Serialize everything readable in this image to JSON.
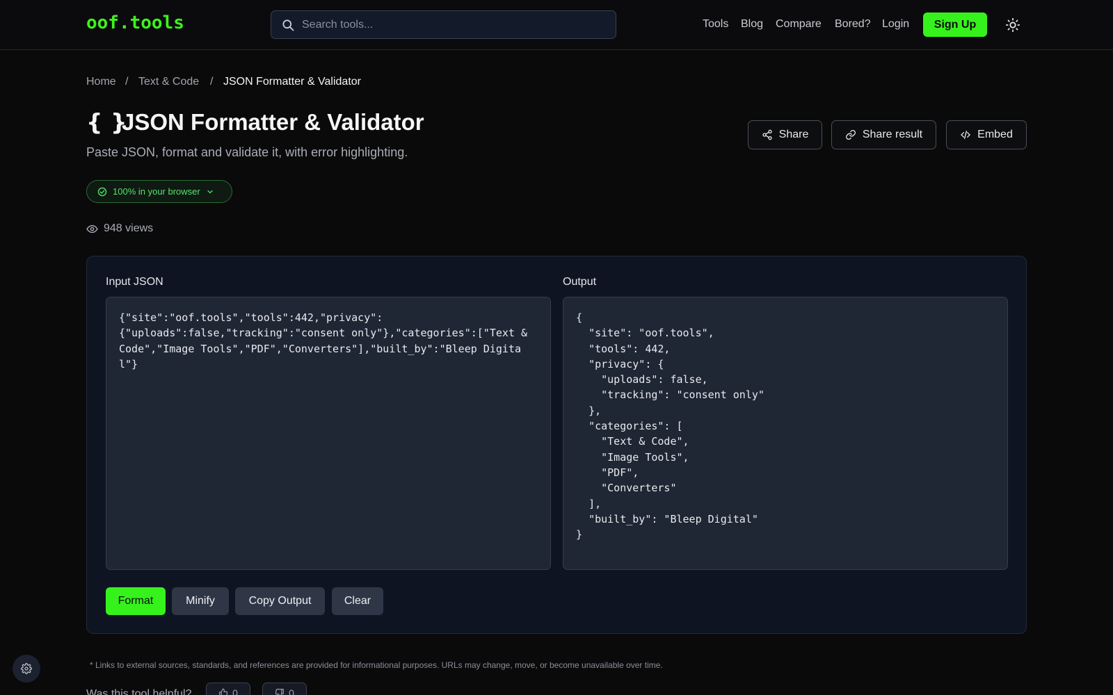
{
  "header": {
    "logo": "oof.tools",
    "search_placeholder": "Search tools...",
    "nav": [
      "Tools",
      "Blog",
      "Compare",
      "Bored?",
      "Login"
    ],
    "signup_label": "Sign Up",
    "theme_icon": "sun-icon"
  },
  "breadcrumb": {
    "items": [
      "Home",
      "Text & Code",
      "JSON Formatter & Validator"
    ],
    "separator": "/"
  },
  "page": {
    "title_icon": "{ }",
    "title": "JSON Formatter & Validator",
    "subtitle": "Paste JSON, format and validate it, with error highlighting.",
    "actions": [
      "Share",
      "Share result",
      "Embed"
    ],
    "badge": "100% in your browser",
    "views": "948 views"
  },
  "tool": {
    "input_label": "Input JSON",
    "output_label": "Output",
    "input_value": "{\"site\":\"oof.tools\",\"tools\":442,\"privacy\":\n{\"uploads\":false,\"tracking\":\"consent only\"},\"categories\":[\"Text &\nCode\",\"Image Tools\",\"PDF\",\"Converters\"],\"built_by\":\"Bleep Digital\"}",
    "output_value": "{\n  \"site\": \"oof.tools\",\n  \"tools\": 442,\n  \"privacy\": {\n    \"uploads\": false,\n    \"tracking\": \"consent only\"\n  },\n  \"categories\": [\n    \"Text & Code\",\n    \"Image Tools\",\n    \"PDF\",\n    \"Converters\"\n  ],\n  \"built_by\": \"Bleep Digital\"\n}",
    "buttons": [
      "Format",
      "Minify",
      "Copy Output",
      "Clear"
    ]
  },
  "footer": {
    "footnote": "* Links to external sources, standards, and references are provided for informational purposes. URLs may change, move, or become unavailable over time.",
    "helpful_question": "Was this tool helpful?",
    "upvotes": "0",
    "downvotes": "0"
  },
  "colors": {
    "accent": "#36f21c",
    "background": "#0a0a0b",
    "panel": "#0f1422",
    "editor": "#1f2634"
  }
}
